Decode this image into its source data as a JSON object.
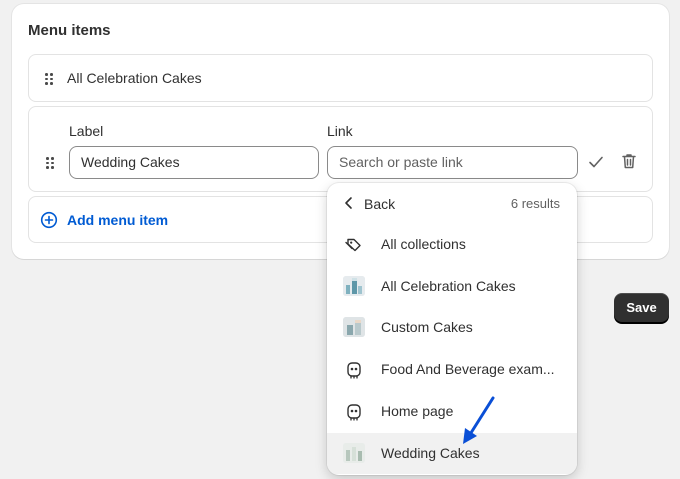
{
  "card": {
    "title": "Menu items"
  },
  "rows": {
    "first": {
      "label": "All Celebration Cakes"
    },
    "edit": {
      "label_heading": "Label",
      "link_heading": "Link",
      "label_value": "Wedding Cakes",
      "link_placeholder": "Search or paste link"
    },
    "add": {
      "label": "Add menu item"
    }
  },
  "save_label": "Save",
  "dropdown": {
    "back_label": "Back",
    "results": "6 results",
    "items": [
      {
        "label": "All collections",
        "icon": "collection-tag-icon"
      },
      {
        "label": "All Celebration Cakes",
        "icon": "cake-thumbnail"
      },
      {
        "label": "Custom Cakes",
        "icon": "cake-thumbnail"
      },
      {
        "label": "Food And Beverage exam...",
        "icon": "page-icon"
      },
      {
        "label": "Home page",
        "icon": "page-icon"
      },
      {
        "label": "Wedding Cakes",
        "icon": "cake-thumbnail",
        "highlighted": true
      }
    ]
  },
  "colors": {
    "accent_blue": "#005bd3",
    "save_button": "#303030",
    "annotation_arrow": "#0a4fd6"
  }
}
